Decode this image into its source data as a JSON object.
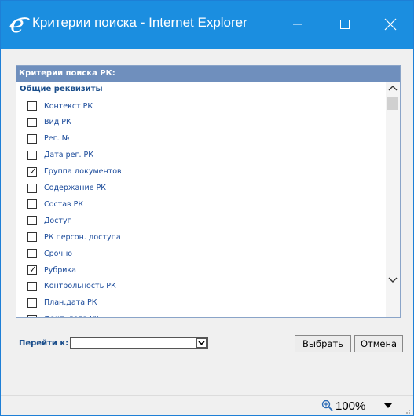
{
  "window": {
    "title": "Критерии поиска - Internet Explorer",
    "accent": "#1b8ee0"
  },
  "panel": {
    "header": "Критерии поиска РК:",
    "group_label": "Общие реквизиты",
    "items": [
      {
        "label": "Контекст РК",
        "checked": false
      },
      {
        "label": "Вид РК",
        "checked": false
      },
      {
        "label": "Рег. №",
        "checked": false
      },
      {
        "label": "Дата рег. РК",
        "checked": false
      },
      {
        "label": "Группа документов",
        "checked": true
      },
      {
        "label": "Содержание РК",
        "checked": false
      },
      {
        "label": "Состав РК",
        "checked": false
      },
      {
        "label": "Доступ",
        "checked": false
      },
      {
        "label": "РК персон. доступа",
        "checked": false
      },
      {
        "label": "Срочно",
        "checked": false
      },
      {
        "label": "Рубрика",
        "checked": true
      },
      {
        "label": "Контрольность РК",
        "checked": false
      },
      {
        "label": "План.дата РК",
        "checked": false
      },
      {
        "label": "Факт. дата РК",
        "checked": false
      }
    ]
  },
  "goto": {
    "label": "Перейти к:",
    "value": ""
  },
  "buttons": {
    "select": "Выбрать",
    "cancel": "Отмена"
  },
  "status": {
    "zoom": "100%"
  },
  "icons": {
    "logo": "internet-explorer-logo",
    "minimize": "minimize-icon",
    "maximize": "maximize-icon",
    "close": "close-icon",
    "scroll_up": "chevron-up-icon",
    "scroll_down": "chevron-down-icon",
    "zoom": "zoom-in-icon"
  }
}
